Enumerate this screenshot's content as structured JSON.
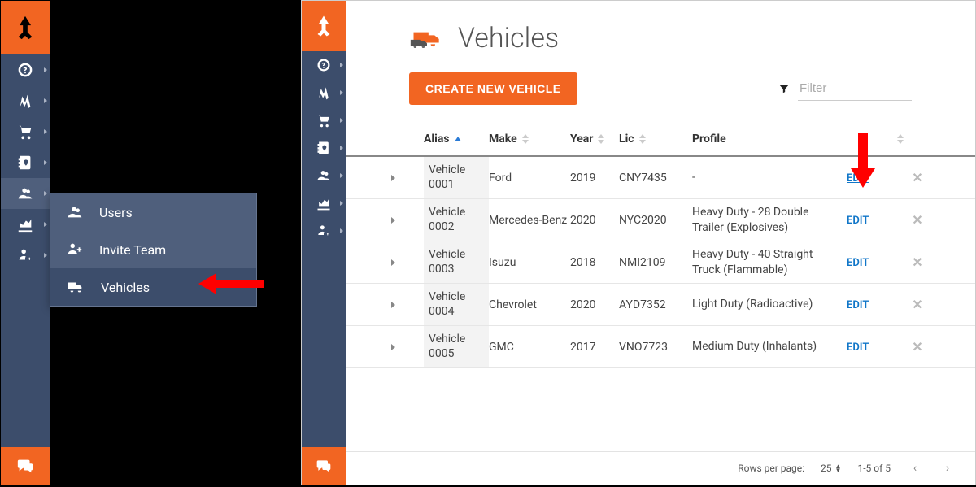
{
  "sidebar": {
    "items": [
      {
        "id": "help",
        "label": "Help"
      },
      {
        "id": "routes",
        "label": "Routes"
      },
      {
        "id": "orders",
        "label": "Orders"
      },
      {
        "id": "addressbook",
        "label": "Address Book"
      },
      {
        "id": "team",
        "label": "Team",
        "active_left": true
      },
      {
        "id": "analytics",
        "label": "Analytics"
      },
      {
        "id": "settings",
        "label": "Settings"
      }
    ]
  },
  "flyout": {
    "items": [
      {
        "label": "Users"
      },
      {
        "label": "Invite Team"
      },
      {
        "label": "Vehicles",
        "hover": true
      }
    ]
  },
  "page": {
    "title": "Vehicles",
    "create_button": "CREATE NEW VEHICLE",
    "filter_placeholder": "Filter"
  },
  "table": {
    "columns": [
      "Alias",
      "Make",
      "Year",
      "Lic",
      "Profile"
    ],
    "edit_label": "EDIT",
    "rows": [
      {
        "alias": "Vehicle 0001",
        "make": "Ford",
        "year": "2019",
        "lic": "CNY7435",
        "profile": "-",
        "highlight_edit": true
      },
      {
        "alias": "Vehicle 0002",
        "make": "Mercedes-Benz",
        "year": "2020",
        "lic": "NYC2020",
        "profile": "Heavy Duty - 28 Double Trailer (Explosives)"
      },
      {
        "alias": "Vehicle 0003",
        "make": "Isuzu",
        "year": "2018",
        "lic": "NMI2109",
        "profile": "Heavy Duty - 40 Straight Truck (Flammable)"
      },
      {
        "alias": "Vehicle 0004",
        "make": "Chevrolet",
        "year": "2020",
        "lic": "AYD7352",
        "profile": "Light Duty (Radioactive)"
      },
      {
        "alias": "Vehicle 0005",
        "make": "GMC",
        "year": "2017",
        "lic": "VNO7723",
        "profile": "Medium Duty (Inhalants)"
      }
    ]
  },
  "pagination": {
    "rows_per_page_label": "Rows per page:",
    "rows_per_page": "25",
    "range": "1-5 of 5"
  },
  "colors": {
    "accent": "#f26522",
    "sidebar": "#3c4d6b",
    "link": "#1076c8",
    "annotation": "#ff0000"
  }
}
